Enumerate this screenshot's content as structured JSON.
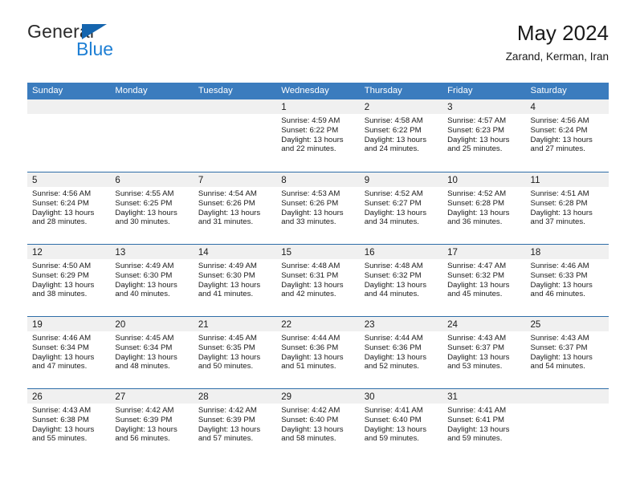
{
  "brand": {
    "name_dark": "General",
    "name_blue": "Blue",
    "logo_icon": "triangle-icon",
    "color_dark": "#2b2b2b",
    "color_blue": "#1e7fd4",
    "triangle_color": "#1565ae"
  },
  "header": {
    "title": "May 2024",
    "subtitle": "Zarand, Kerman, Iran"
  },
  "colors": {
    "header_bar": "#3b7cbe",
    "row_separator": "#2e6da8",
    "daynum_band": "#f0f0f0",
    "text": "#1a1a1a"
  },
  "weekdays": [
    "Sunday",
    "Monday",
    "Tuesday",
    "Wednesday",
    "Thursday",
    "Friday",
    "Saturday"
  ],
  "weeks": [
    [
      {
        "day": "",
        "lines": []
      },
      {
        "day": "",
        "lines": []
      },
      {
        "day": "",
        "lines": []
      },
      {
        "day": "1",
        "lines": [
          "Sunrise: 4:59 AM",
          "Sunset: 6:22 PM",
          "Daylight: 13 hours",
          "and 22 minutes."
        ]
      },
      {
        "day": "2",
        "lines": [
          "Sunrise: 4:58 AM",
          "Sunset: 6:22 PM",
          "Daylight: 13 hours",
          "and 24 minutes."
        ]
      },
      {
        "day": "3",
        "lines": [
          "Sunrise: 4:57 AM",
          "Sunset: 6:23 PM",
          "Daylight: 13 hours",
          "and 25 minutes."
        ]
      },
      {
        "day": "4",
        "lines": [
          "Sunrise: 4:56 AM",
          "Sunset: 6:24 PM",
          "Daylight: 13 hours",
          "and 27 minutes."
        ]
      }
    ],
    [
      {
        "day": "5",
        "lines": [
          "Sunrise: 4:56 AM",
          "Sunset: 6:24 PM",
          "Daylight: 13 hours",
          "and 28 minutes."
        ]
      },
      {
        "day": "6",
        "lines": [
          "Sunrise: 4:55 AM",
          "Sunset: 6:25 PM",
          "Daylight: 13 hours",
          "and 30 minutes."
        ]
      },
      {
        "day": "7",
        "lines": [
          "Sunrise: 4:54 AM",
          "Sunset: 6:26 PM",
          "Daylight: 13 hours",
          "and 31 minutes."
        ]
      },
      {
        "day": "8",
        "lines": [
          "Sunrise: 4:53 AM",
          "Sunset: 6:26 PM",
          "Daylight: 13 hours",
          "and 33 minutes."
        ]
      },
      {
        "day": "9",
        "lines": [
          "Sunrise: 4:52 AM",
          "Sunset: 6:27 PM",
          "Daylight: 13 hours",
          "and 34 minutes."
        ]
      },
      {
        "day": "10",
        "lines": [
          "Sunrise: 4:52 AM",
          "Sunset: 6:28 PM",
          "Daylight: 13 hours",
          "and 36 minutes."
        ]
      },
      {
        "day": "11",
        "lines": [
          "Sunrise: 4:51 AM",
          "Sunset: 6:28 PM",
          "Daylight: 13 hours",
          "and 37 minutes."
        ]
      }
    ],
    [
      {
        "day": "12",
        "lines": [
          "Sunrise: 4:50 AM",
          "Sunset: 6:29 PM",
          "Daylight: 13 hours",
          "and 38 minutes."
        ]
      },
      {
        "day": "13",
        "lines": [
          "Sunrise: 4:49 AM",
          "Sunset: 6:30 PM",
          "Daylight: 13 hours",
          "and 40 minutes."
        ]
      },
      {
        "day": "14",
        "lines": [
          "Sunrise: 4:49 AM",
          "Sunset: 6:30 PM",
          "Daylight: 13 hours",
          "and 41 minutes."
        ]
      },
      {
        "day": "15",
        "lines": [
          "Sunrise: 4:48 AM",
          "Sunset: 6:31 PM",
          "Daylight: 13 hours",
          "and 42 minutes."
        ]
      },
      {
        "day": "16",
        "lines": [
          "Sunrise: 4:48 AM",
          "Sunset: 6:32 PM",
          "Daylight: 13 hours",
          "and 44 minutes."
        ]
      },
      {
        "day": "17",
        "lines": [
          "Sunrise: 4:47 AM",
          "Sunset: 6:32 PM",
          "Daylight: 13 hours",
          "and 45 minutes."
        ]
      },
      {
        "day": "18",
        "lines": [
          "Sunrise: 4:46 AM",
          "Sunset: 6:33 PM",
          "Daylight: 13 hours",
          "and 46 minutes."
        ]
      }
    ],
    [
      {
        "day": "19",
        "lines": [
          "Sunrise: 4:46 AM",
          "Sunset: 6:34 PM",
          "Daylight: 13 hours",
          "and 47 minutes."
        ]
      },
      {
        "day": "20",
        "lines": [
          "Sunrise: 4:45 AM",
          "Sunset: 6:34 PM",
          "Daylight: 13 hours",
          "and 48 minutes."
        ]
      },
      {
        "day": "21",
        "lines": [
          "Sunrise: 4:45 AM",
          "Sunset: 6:35 PM",
          "Daylight: 13 hours",
          "and 50 minutes."
        ]
      },
      {
        "day": "22",
        "lines": [
          "Sunrise: 4:44 AM",
          "Sunset: 6:36 PM",
          "Daylight: 13 hours",
          "and 51 minutes."
        ]
      },
      {
        "day": "23",
        "lines": [
          "Sunrise: 4:44 AM",
          "Sunset: 6:36 PM",
          "Daylight: 13 hours",
          "and 52 minutes."
        ]
      },
      {
        "day": "24",
        "lines": [
          "Sunrise: 4:43 AM",
          "Sunset: 6:37 PM",
          "Daylight: 13 hours",
          "and 53 minutes."
        ]
      },
      {
        "day": "25",
        "lines": [
          "Sunrise: 4:43 AM",
          "Sunset: 6:37 PM",
          "Daylight: 13 hours",
          "and 54 minutes."
        ]
      }
    ],
    [
      {
        "day": "26",
        "lines": [
          "Sunrise: 4:43 AM",
          "Sunset: 6:38 PM",
          "Daylight: 13 hours",
          "and 55 minutes."
        ]
      },
      {
        "day": "27",
        "lines": [
          "Sunrise: 4:42 AM",
          "Sunset: 6:39 PM",
          "Daylight: 13 hours",
          "and 56 minutes."
        ]
      },
      {
        "day": "28",
        "lines": [
          "Sunrise: 4:42 AM",
          "Sunset: 6:39 PM",
          "Daylight: 13 hours",
          "and 57 minutes."
        ]
      },
      {
        "day": "29",
        "lines": [
          "Sunrise: 4:42 AM",
          "Sunset: 6:40 PM",
          "Daylight: 13 hours",
          "and 58 minutes."
        ]
      },
      {
        "day": "30",
        "lines": [
          "Sunrise: 4:41 AM",
          "Sunset: 6:40 PM",
          "Daylight: 13 hours",
          "and 59 minutes."
        ]
      },
      {
        "day": "31",
        "lines": [
          "Sunrise: 4:41 AM",
          "Sunset: 6:41 PM",
          "Daylight: 13 hours",
          "and 59 minutes."
        ]
      },
      {
        "day": "",
        "lines": []
      }
    ]
  ]
}
